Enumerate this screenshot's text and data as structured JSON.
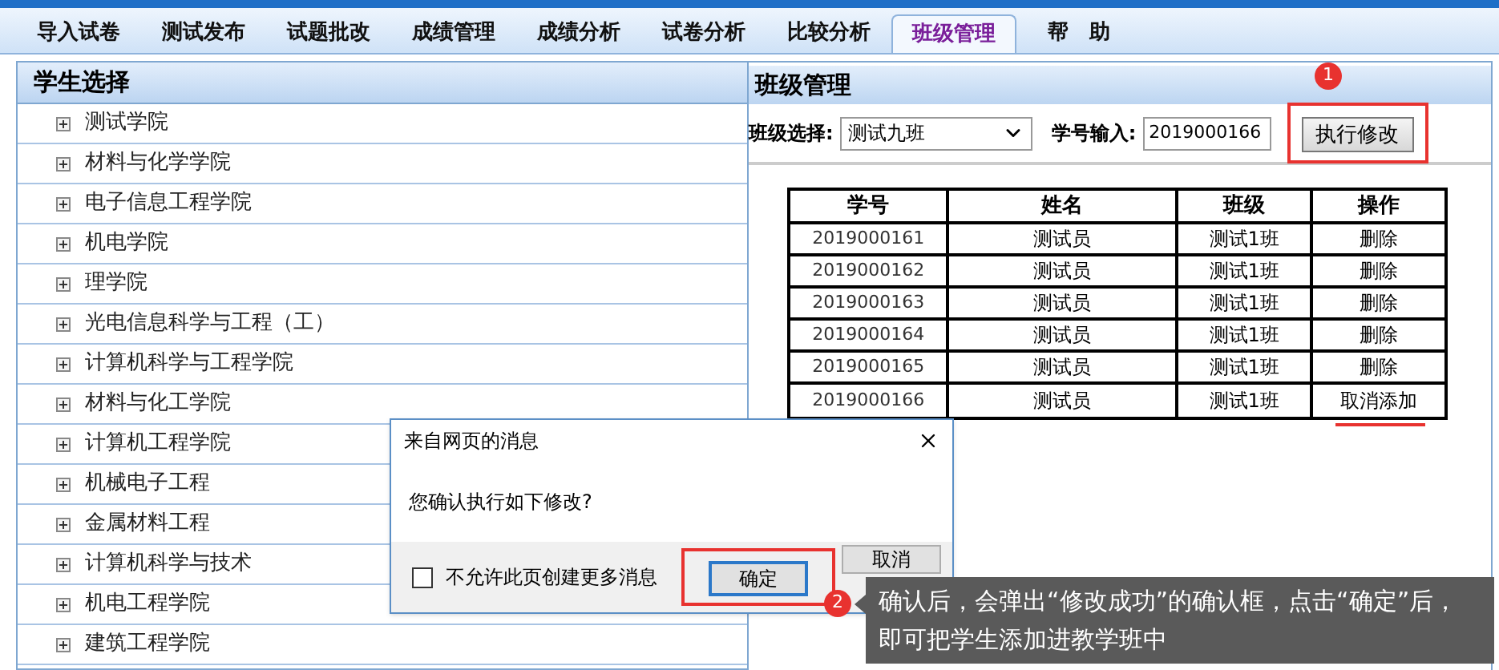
{
  "tabs": [
    {
      "label": "导入试卷",
      "selected": false
    },
    {
      "label": "测试发布",
      "selected": false
    },
    {
      "label": "试题批改",
      "selected": false
    },
    {
      "label": "成绩管理",
      "selected": false
    },
    {
      "label": "成绩分析",
      "selected": false
    },
    {
      "label": "试卷分析",
      "selected": false
    },
    {
      "label": "比较分析",
      "selected": false
    },
    {
      "label": "班级管理",
      "selected": true
    },
    {
      "label": "帮　助",
      "selected": false
    }
  ],
  "student_panel": {
    "title": "学生选择",
    "items": [
      {
        "label": "测试学院",
        "expanded": false
      },
      {
        "label": "材料与化学学院",
        "expanded": false
      },
      {
        "label": "电子信息工程学院",
        "expanded": false
      },
      {
        "label": "机电学院",
        "expanded": false
      },
      {
        "label": "理学院",
        "expanded": false
      },
      {
        "label": "光电信息科学与工程（工）",
        "expanded": false
      },
      {
        "label": "计算机科学与工程学院",
        "expanded": false
      },
      {
        "label": "材料与化工学院",
        "expanded": false
      },
      {
        "label": "计算机工程学院",
        "expanded": false
      },
      {
        "label": "机械电子工程",
        "expanded": false
      },
      {
        "label": "金属材料工程",
        "expanded": false
      },
      {
        "label": "计算机科学与技术",
        "expanded": false
      },
      {
        "label": "机电工程学院",
        "expanded": false
      },
      {
        "label": "建筑工程学院",
        "expanded": false
      }
    ]
  },
  "class_panel": {
    "title": "班级管理",
    "class_select": {
      "label": "班级选择:",
      "value": "测试九班"
    },
    "id_input": {
      "label": "学号输入:",
      "value": "2019000166"
    },
    "submit_button": "执行修改",
    "table": {
      "columns": [
        "学号",
        "姓名",
        "班级",
        "操作"
      ],
      "rows": [
        [
          "2019000161",
          "测试员",
          "测试1班",
          "删除"
        ],
        [
          "2019000162",
          "测试员",
          "测试1班",
          "删除"
        ],
        [
          "2019000163",
          "测试员",
          "测试1班",
          "删除"
        ],
        [
          "2019000164",
          "测试员",
          "测试1班",
          "删除"
        ],
        [
          "2019000165",
          "测试员",
          "测试1班",
          "删除"
        ],
        [
          "2019000166",
          "测试员",
          "测试1班",
          "取消添加"
        ]
      ]
    }
  },
  "dialog": {
    "title": "来自网页的消息",
    "message": "您确认执行如下修改?",
    "checkbox": {
      "label": "不允许此页创建更多消息",
      "checked": false
    },
    "buttons": [
      "确定",
      "取消"
    ]
  },
  "callouts": [
    {
      "number": "1"
    },
    {
      "number": "2",
      "text": "确认后，会弹出“修改成功”的确认框，点击“确定”后，即可把学生添加进教学班中"
    }
  ]
}
